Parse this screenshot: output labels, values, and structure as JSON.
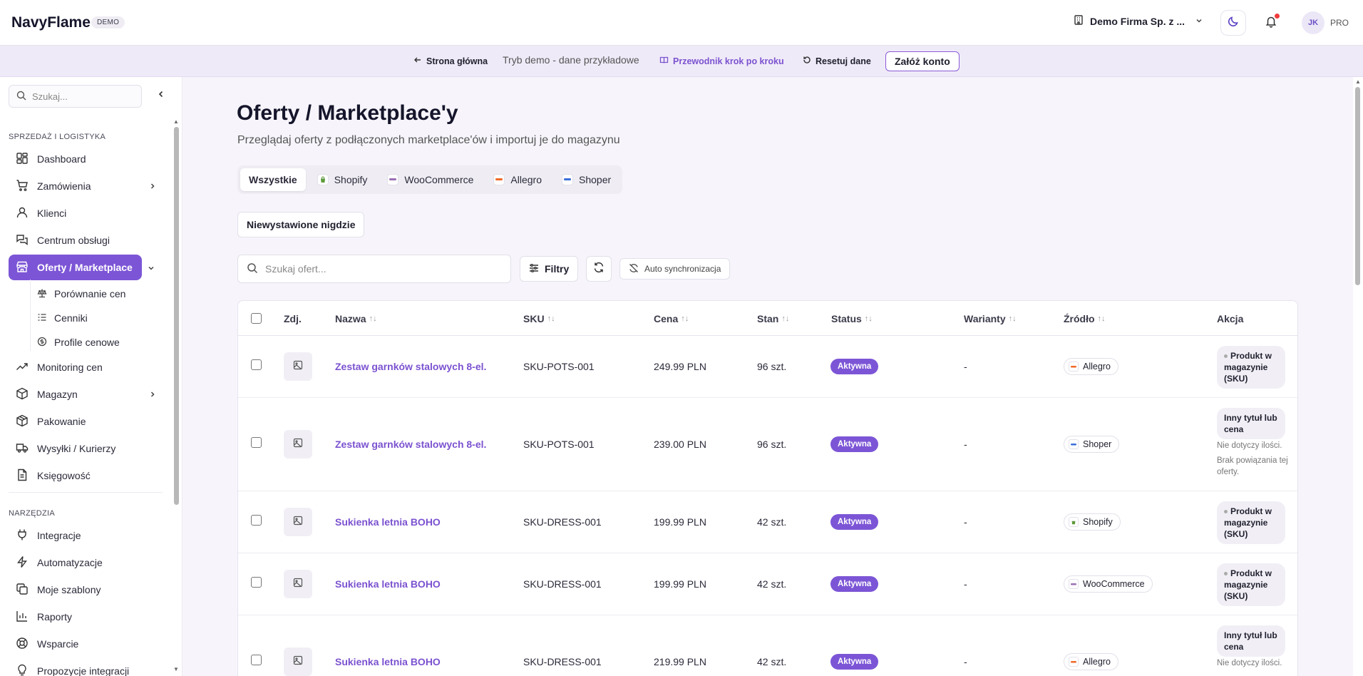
{
  "header": {
    "brand": "NavyFlame",
    "badge": "DEMO",
    "company": "Demo Firma Sp. z ...",
    "avatar_initials": "JK",
    "plan": "PRO"
  },
  "demobar": {
    "home": "Strona główna",
    "mode": "Tryb demo - dane przykładowe",
    "guide": "Przewodnik krok po kroku",
    "reset": "Resetuj dane",
    "signup": "Załóż konto"
  },
  "sidebar": {
    "search_placeholder": "Szukaj...",
    "section_sales": "SPRZEDAŻ I LOGISTYKA",
    "section_tools": "NARZĘDZIA",
    "items": [
      {
        "label": "Dashboard",
        "icon": "dashboard-icon"
      },
      {
        "label": "Zamówienia",
        "icon": "cart-icon"
      },
      {
        "label": "Klienci",
        "icon": "user-icon"
      },
      {
        "label": "Centrum obsługi",
        "icon": "chat-icon"
      },
      {
        "label": "Oferty / Marketplace",
        "icon": "store-icon"
      },
      {
        "label": "Monitoring cen",
        "icon": "trend-icon"
      },
      {
        "label": "Magazyn",
        "icon": "box-icon"
      },
      {
        "label": "Pakowanie",
        "icon": "package-icon"
      },
      {
        "label": "Wysyłki / Kurierzy",
        "icon": "truck-icon"
      },
      {
        "label": "Księgowość",
        "icon": "document-icon"
      }
    ],
    "subitems": [
      {
        "label": "Porównanie cen",
        "icon": "scale-icon"
      },
      {
        "label": "Cenniki",
        "icon": "list-icon"
      },
      {
        "label": "Profile cenowe",
        "icon": "coin-icon"
      }
    ],
    "tools": [
      {
        "label": "Integracje",
        "icon": "plug-icon"
      },
      {
        "label": "Automatyzacje",
        "icon": "bolt-icon"
      },
      {
        "label": "Moje szablony",
        "icon": "copy-icon"
      },
      {
        "label": "Raporty",
        "icon": "chart-icon"
      },
      {
        "label": "Wsparcie",
        "icon": "support-icon"
      },
      {
        "label": "Propozycje integracji",
        "icon": "bulb-icon"
      }
    ]
  },
  "main": {
    "title": "Oferty / Marketplace'y",
    "subtitle": "Przeglądaj oferty z podłączonych marketplace'ów i importuj je do magazynu",
    "tabs": [
      "Wszystkie",
      "Shopify",
      "WooCommerce",
      "Allegro",
      "Shoper"
    ],
    "unlisted": "Niewystawione nigdzie",
    "search_placeholder": "Szukaj ofert...",
    "filters": "Filtry",
    "autosync": "Auto synchronizacja"
  },
  "table": {
    "headers": {
      "img": "Zdj.",
      "name": "Nazwa",
      "sku": "SKU",
      "price": "Cena",
      "stock": "Stan",
      "status": "Status",
      "variants": "Warianty",
      "source": "Źródło",
      "action": "Akcja"
    },
    "rows": [
      {
        "name": "Zestaw garnków stalowych 8-el.",
        "sku": "SKU-POTS-001",
        "price": "249.99 PLN",
        "stock": "96 szt.",
        "status": "Aktywna",
        "variants": "-",
        "source": "Allegro",
        "action": "Produkt w magazynie (SKU)",
        "note": ""
      },
      {
        "name": "Zestaw garnków stalowych 8-el.",
        "sku": "SKU-POTS-001",
        "price": "239.00 PLN",
        "stock": "96 szt.",
        "status": "Aktywna",
        "variants": "-",
        "source": "Shoper",
        "action": "Inny tytuł lub cena",
        "note": "Nie dotyczy ilości.",
        "note2": "Brak powiązania tej oferty."
      },
      {
        "name": "Sukienka letnia BOHO",
        "sku": "SKU-DRESS-001",
        "price": "199.99 PLN",
        "stock": "42 szt.",
        "status": "Aktywna",
        "variants": "-",
        "source": "Shopify",
        "action": "Produkt w magazynie (SKU)",
        "note": ""
      },
      {
        "name": "Sukienka letnia BOHO",
        "sku": "SKU-DRESS-001",
        "price": "199.99 PLN",
        "stock": "42 szt.",
        "status": "Aktywna",
        "variants": "-",
        "source": "WooCommerce",
        "action": "Produkt w magazynie (SKU)",
        "note": ""
      },
      {
        "name": "Sukienka letnia BOHO",
        "sku": "SKU-DRESS-001",
        "price": "219.99 PLN",
        "stock": "42 szt.",
        "status": "Aktywna",
        "variants": "-",
        "source": "Allegro",
        "action": "Inny tytuł lub cena",
        "note": "Nie dotyczy ilości."
      }
    ]
  },
  "colors": {
    "accent": "#7c55d6",
    "link": "#7b52d0",
    "notification": "#ef3b3b"
  }
}
